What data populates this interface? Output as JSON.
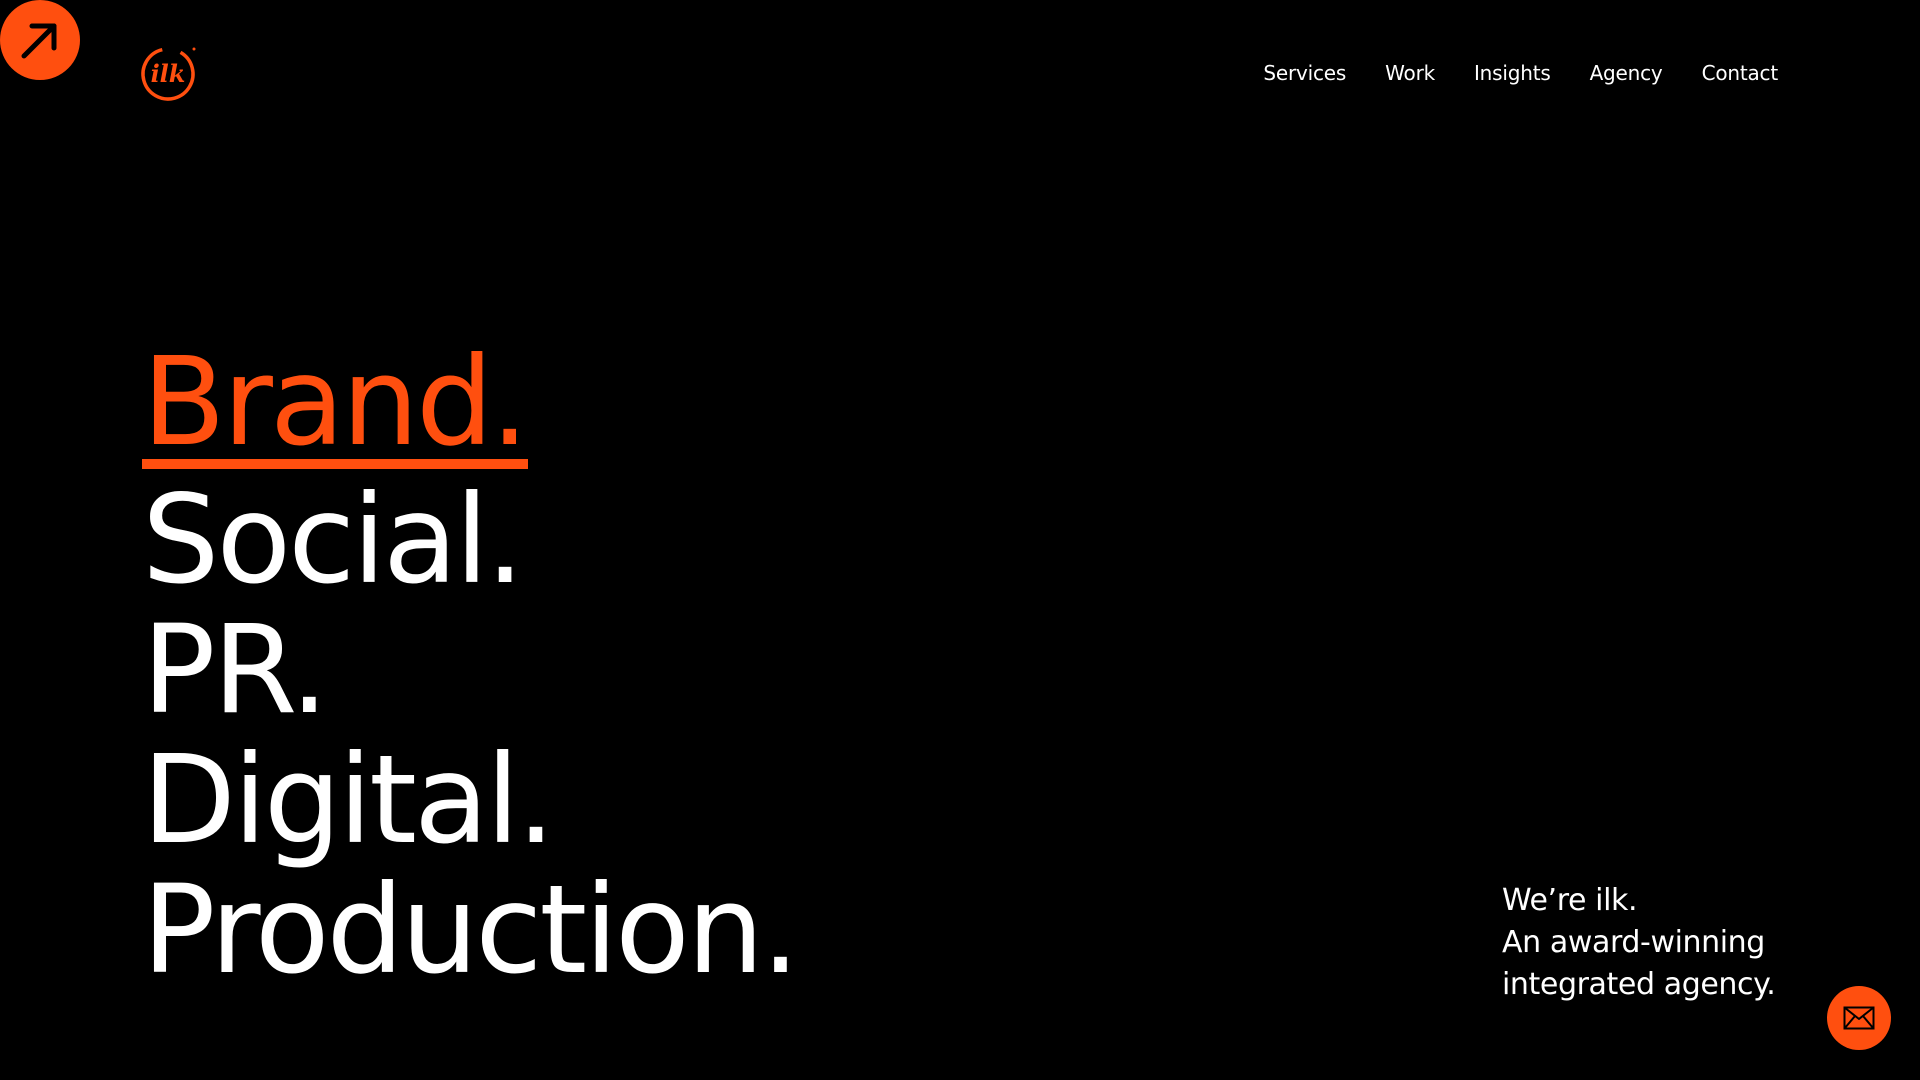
{
  "colors": {
    "background": "#000000",
    "accent": "#ff4f0f",
    "text": "#ffffff"
  },
  "corner_badge": {
    "icon": "arrow-up-right-icon"
  },
  "logo": {
    "icon": "ilk-logo-icon",
    "text": "ilk"
  },
  "nav": {
    "items": [
      {
        "label": "Services"
      },
      {
        "label": "Work"
      },
      {
        "label": "Insights"
      },
      {
        "label": "Agency"
      },
      {
        "label": "Contact"
      }
    ]
  },
  "hero": {
    "lines": [
      {
        "text": "Brand.",
        "active": true
      },
      {
        "text": "Social.",
        "active": false
      },
      {
        "text": "PR.",
        "active": false
      },
      {
        "text": "Digital.",
        "active": false
      },
      {
        "text": "Production.",
        "active": false
      }
    ]
  },
  "tagline": {
    "lines": [
      "We’re ilk.",
      "An award-winning",
      "integrated agency."
    ]
  },
  "mail_button": {
    "icon": "mail-icon"
  }
}
